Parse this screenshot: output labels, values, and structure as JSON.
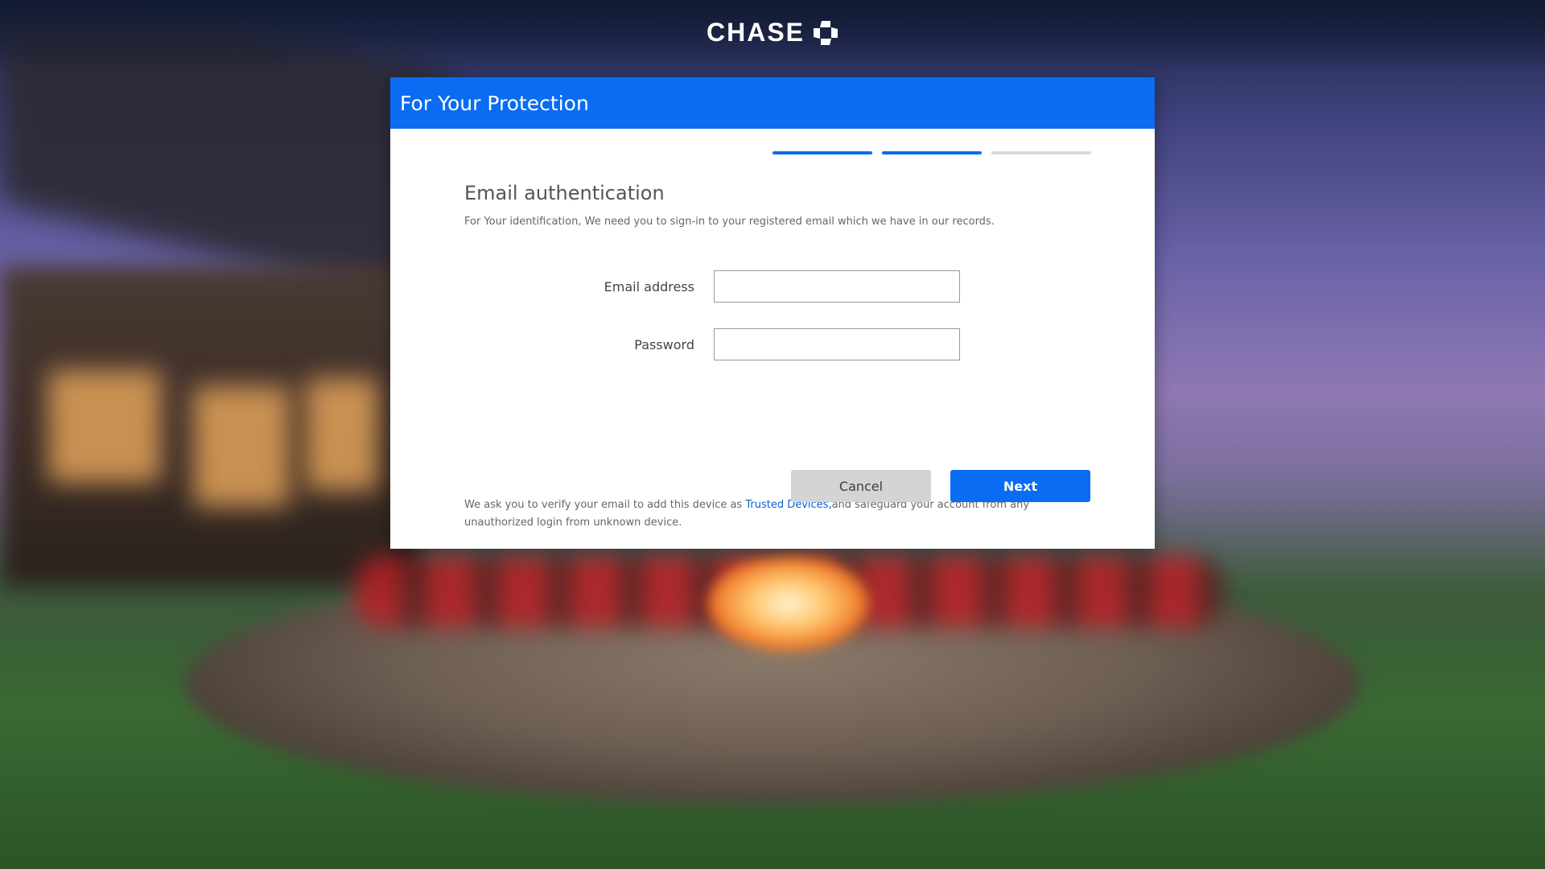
{
  "brand": {
    "name": "CHASE",
    "logo_icon": "chase-octagon-icon"
  },
  "dialog": {
    "title": "For Your Protection",
    "header_color": "#0a6cf2",
    "steps": [
      {
        "state": "complete",
        "color": "#0a6cf2"
      },
      {
        "state": "current",
        "color": "#0a6cf2"
      },
      {
        "state": "pending",
        "color": "#d9d9d9"
      }
    ]
  },
  "auth": {
    "section_title": "Email authentication",
    "intro": "For Your identification, We need you to sign-in to your registered email which we have in our records.",
    "email_label": "Email address",
    "email_value": "",
    "password_label": "Password",
    "password_value": "",
    "note_before_link": "We ask you to verify your email to add this device as ",
    "note_link": "Trusted Devices,",
    "note_after_link": "and safeguard your account from any unauthorized login from unknown device."
  },
  "actions": {
    "cancel_label": "Cancel",
    "next_label": "Next"
  }
}
